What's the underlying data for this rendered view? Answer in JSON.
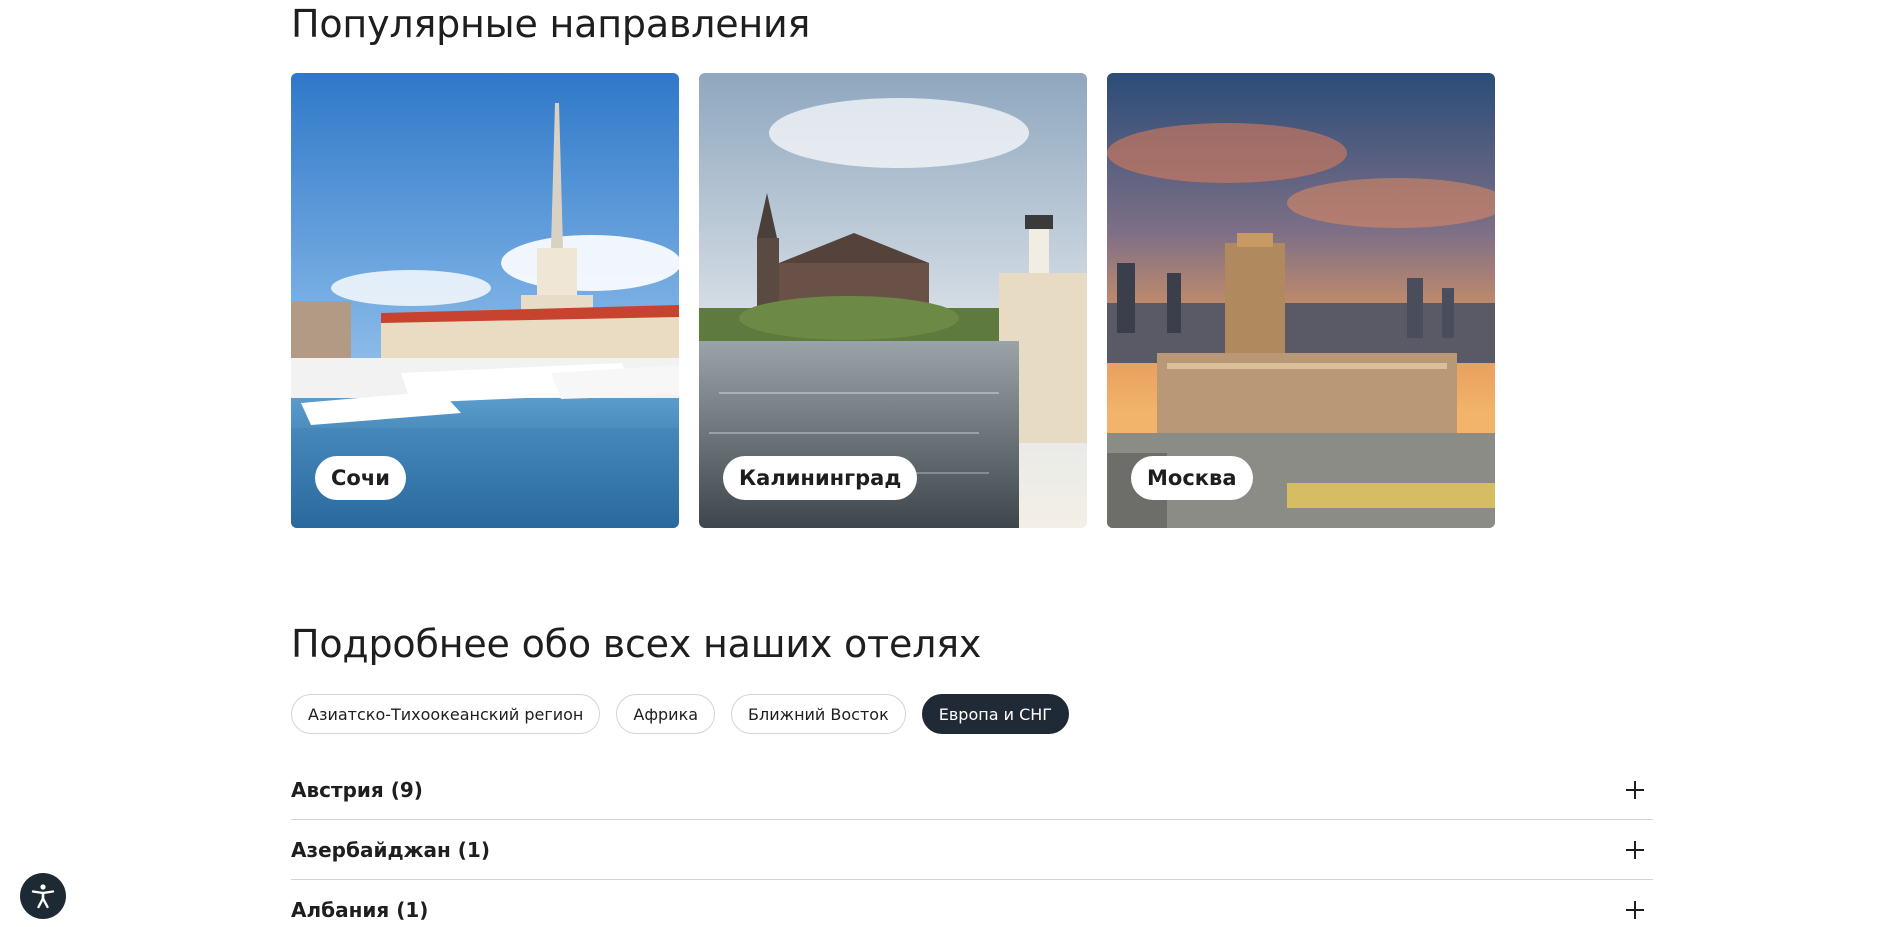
{
  "popular": {
    "title": "Популярные направления",
    "cards": [
      {
        "label": "Сочи",
        "image": "sochi-seaport-photo"
      },
      {
        "label": "Калининград",
        "image": "kaliningrad-cathedral-photo"
      },
      {
        "label": "Москва",
        "image": "moscow-sunset-photo"
      }
    ]
  },
  "hotels": {
    "title": "Подробнее обо всех наших отелях",
    "regions": [
      {
        "label": "Азиатско-Тихоокеанский регион",
        "active": false
      },
      {
        "label": "Африка",
        "active": false
      },
      {
        "label": "Ближний Восток",
        "active": false
      },
      {
        "label": "Европа и СНГ",
        "active": true
      }
    ],
    "countries": [
      {
        "label": "Австрия (9)"
      },
      {
        "label": "Азербайджан (1)"
      },
      {
        "label": "Албания (1)"
      }
    ]
  },
  "accessibility": {
    "icon": "accessibility-icon"
  },
  "colors": {
    "active_chip": "#1f2a36",
    "text": "#1e1e1e",
    "divider": "#d4d4d4"
  }
}
